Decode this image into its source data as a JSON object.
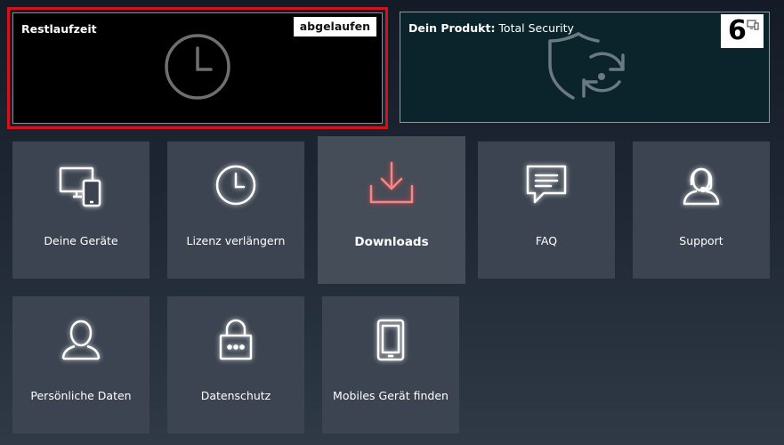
{
  "remaining": {
    "title": "Restlaufzeit",
    "status_badge": "abgelaufen",
    "icon": "clock-icon"
  },
  "product": {
    "title_prefix": "Dein Produkt:",
    "title_name": " Total Security",
    "device_count": "6",
    "icon": "shield-refresh-icon"
  },
  "tiles": [
    {
      "label": "Deine Geräte",
      "icon": "devices-icon"
    },
    {
      "label": "Lizenz verlängern",
      "icon": "clock-icon"
    },
    {
      "label": "Downloads",
      "icon": "download-icon"
    },
    {
      "label": "FAQ",
      "icon": "chat-icon"
    },
    {
      "label": "Support",
      "icon": "headset-icon"
    },
    {
      "label": "Persönliche Daten",
      "icon": "user-icon"
    },
    {
      "label": "Datenschutz",
      "icon": "lock-icon"
    },
    {
      "label": "Mobiles Gerät finden",
      "icon": "phone-icon"
    }
  ],
  "colors": {
    "alert_border": "#d2121c",
    "download_accent": "#e24f4f"
  }
}
